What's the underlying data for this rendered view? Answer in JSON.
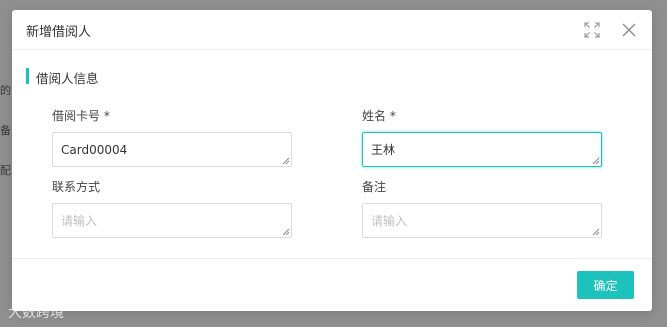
{
  "background": {
    "fragments": [
      "的",
      "备",
      "配"
    ]
  },
  "dialog": {
    "title": "新增借阅人",
    "section_title": "借阅人信息",
    "fields": {
      "card_no": {
        "label": "借阅卡号 *",
        "value": "Card00004",
        "placeholder": ""
      },
      "name": {
        "label": "姓名 *",
        "value": "王林",
        "placeholder": ""
      },
      "contact": {
        "label": "联系方式",
        "value": "",
        "placeholder": "请输入"
      },
      "remark": {
        "label": "备注",
        "value": "",
        "placeholder": "请输入"
      }
    },
    "confirm_label": "确定"
  },
  "icons": {
    "expand": "expand-icon",
    "close": "close-icon"
  },
  "colors": {
    "accent": "#1ec2bd",
    "backdrop": "#8f8f8f"
  },
  "watermark": "大数跨境"
}
